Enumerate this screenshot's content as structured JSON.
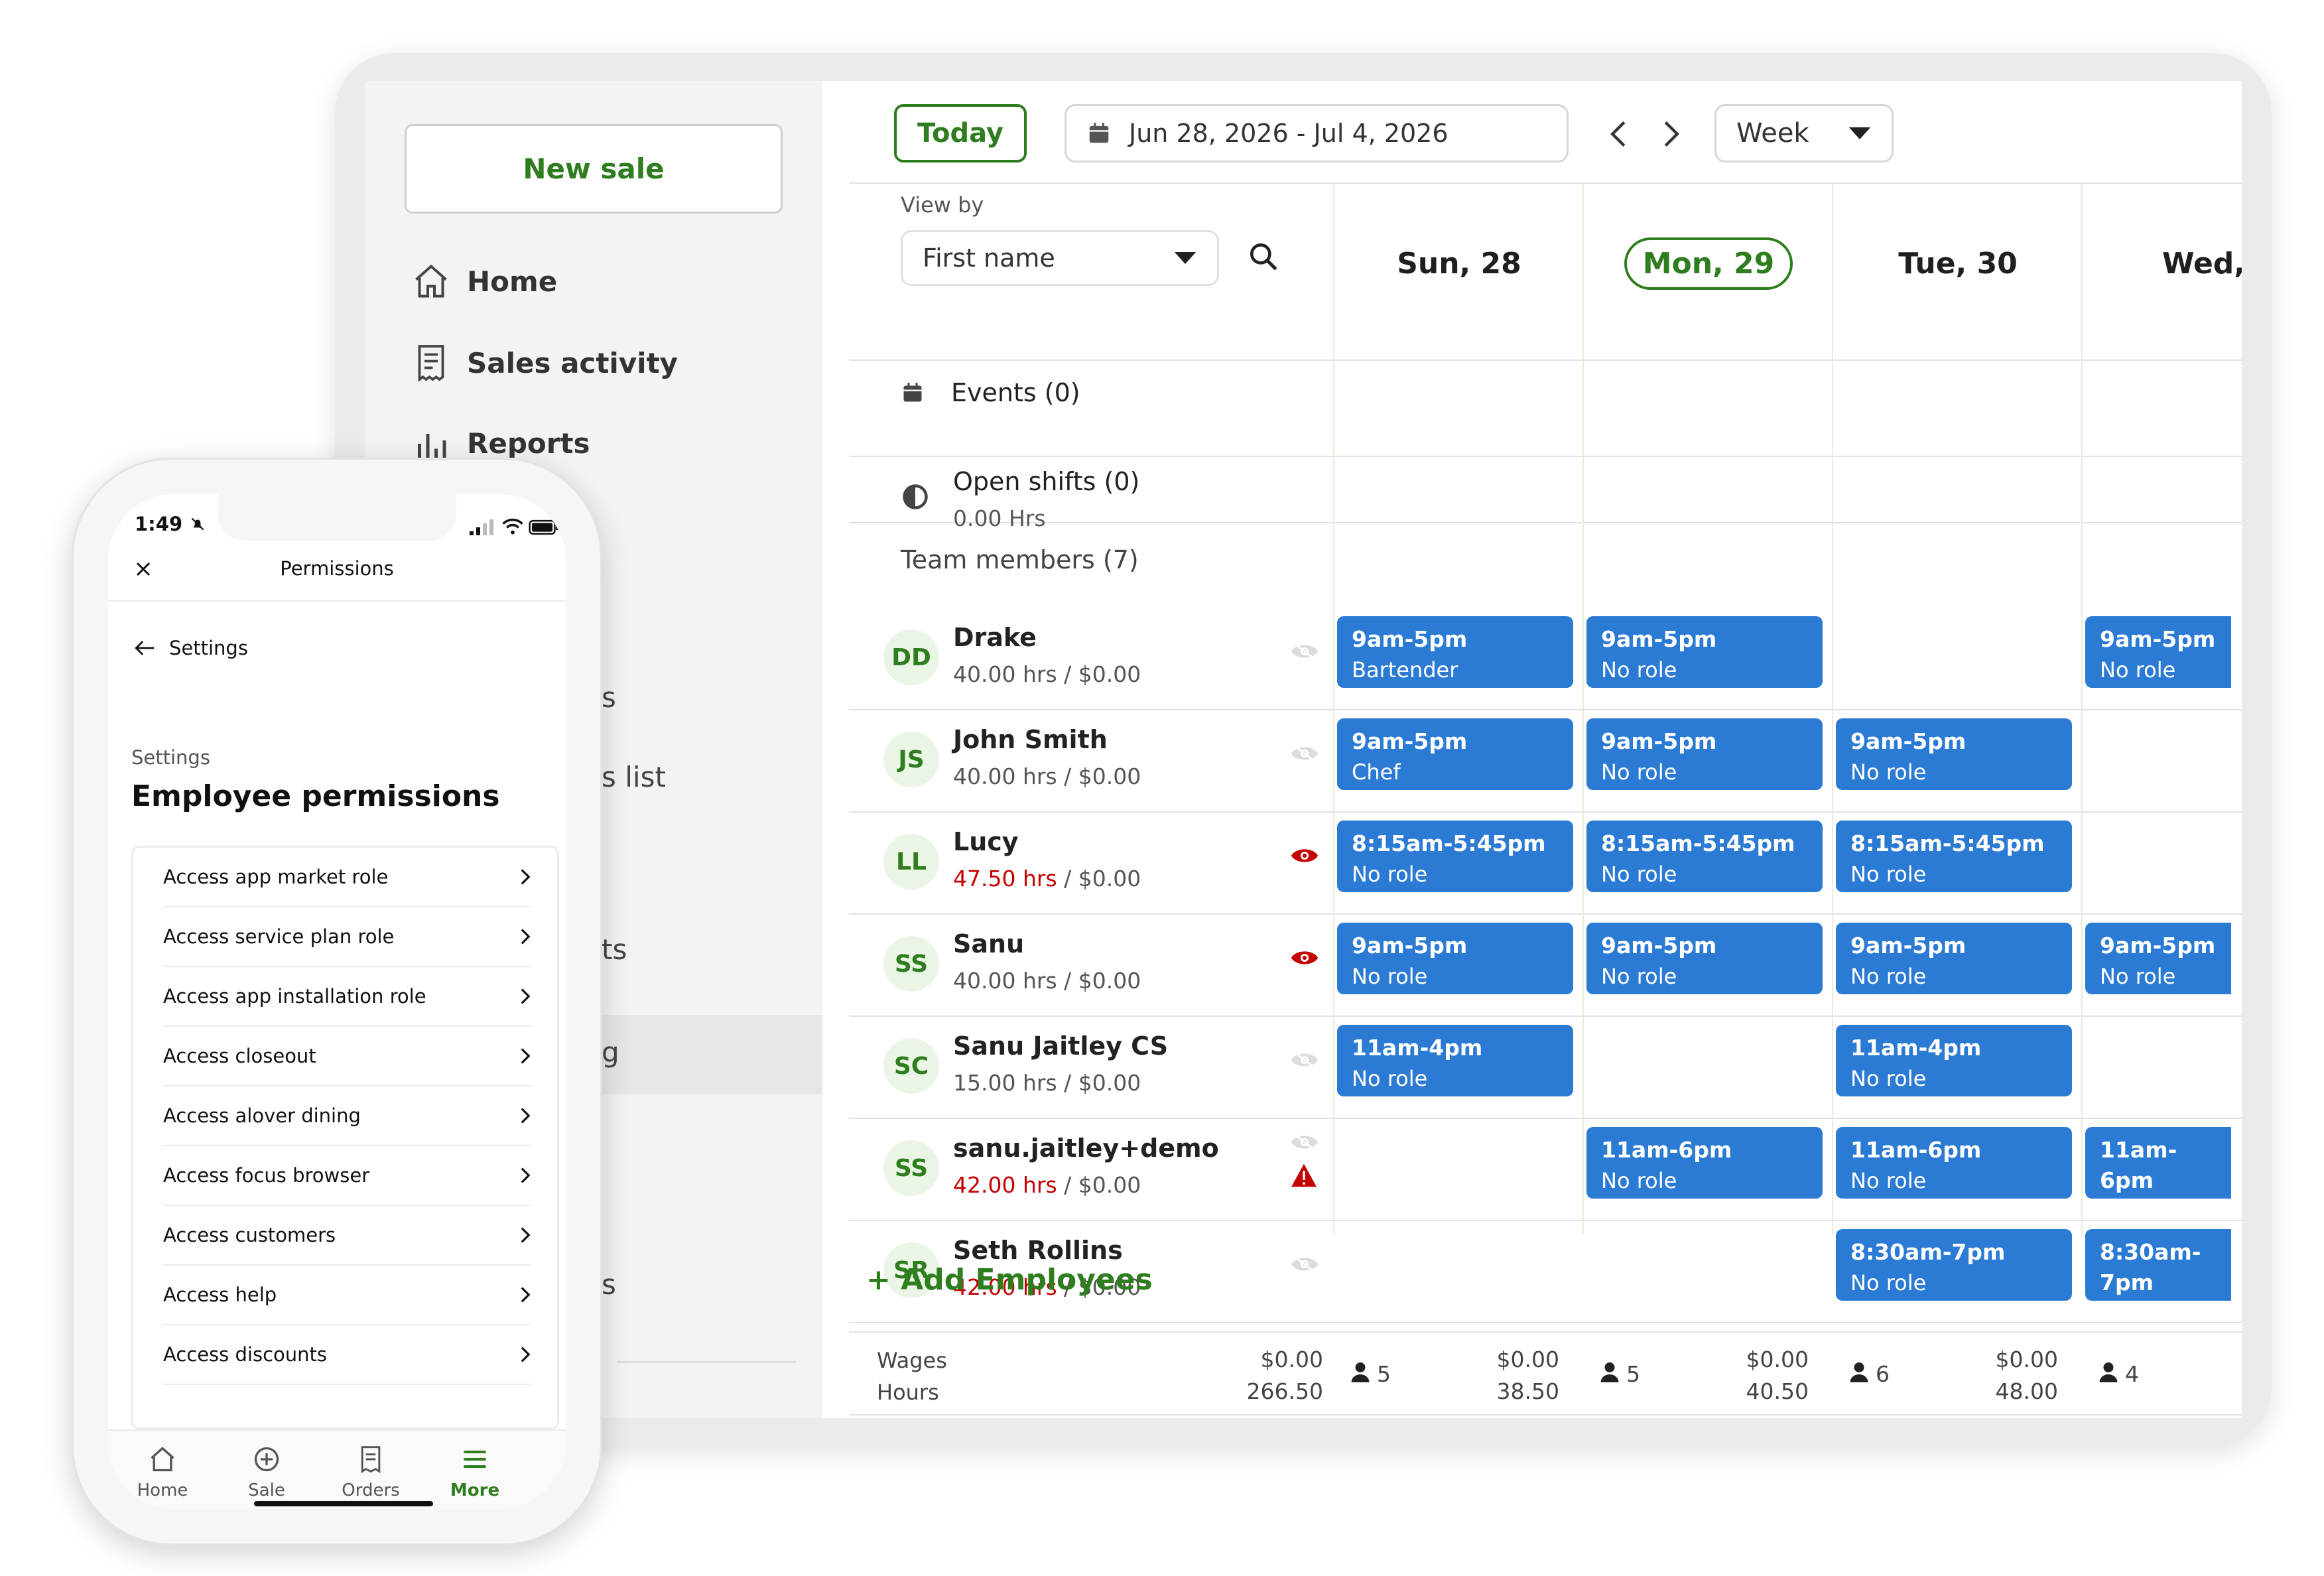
{
  "sidebar": {
    "new_sale": "New sale",
    "items": [
      {
        "label": "Home",
        "icon": "home-icon"
      },
      {
        "label": "Sales activity",
        "icon": "receipt-icon"
      },
      {
        "label": "Reports",
        "icon": "bar-chart-icon"
      }
    ],
    "fragments": [
      "s",
      "s list",
      "ts",
      "g",
      "s"
    ]
  },
  "toolbar": {
    "today": "Today",
    "date_range": "Jun 28, 2026 - Jul 4, 2026",
    "view_mode": "Week"
  },
  "grid": {
    "view_by_label": "View by",
    "view_by_value": "First name",
    "events": "Events (0)",
    "open_shifts": "Open shifts (0)",
    "open_shifts_hours": "0.00 Hrs",
    "team_members": "Team members (7)",
    "days": [
      "Sun, 28",
      "Mon, 29",
      "Tue, 30",
      "Wed,"
    ],
    "add_employees": "+ Add Employees",
    "footer": {
      "wages_label": "Wages",
      "hours_label": "Hours",
      "total_wages": "$0.00",
      "total_hours": "266.50",
      "days": [
        {
          "count": "5",
          "wages": "$0.00",
          "hours": "38.50"
        },
        {
          "count": "5",
          "wages": "$0.00",
          "hours": "40.50"
        },
        {
          "count": "6",
          "wages": "$0.00",
          "hours": "48.00"
        },
        {
          "count": "4",
          "wages": "",
          "hours": ""
        }
      ]
    }
  },
  "employees": [
    {
      "initials": "DD",
      "name": "Drake",
      "hours": "40.00 hrs",
      "pay": " / $0.00",
      "over": false,
      "visibility": "hidden"
    },
    {
      "initials": "JS",
      "name": "John Smith",
      "hours": "40.00 hrs",
      "pay": " / $0.00",
      "over": false,
      "visibility": "hidden"
    },
    {
      "initials": "LL",
      "name": "Lucy",
      "hours": "47.50 hrs",
      "pay": " / $0.00",
      "over": true,
      "visibility": "visible"
    },
    {
      "initials": "SS",
      "name": "Sanu",
      "hours": "40.00 hrs",
      "pay": " / $0.00",
      "over": false,
      "visibility": "visible"
    },
    {
      "initials": "SC",
      "name": "Sanu Jaitley CS",
      "hours": "15.00 hrs",
      "pay": " / $0.00",
      "over": false,
      "visibility": "hidden"
    },
    {
      "initials": "SS",
      "name": "sanu.jaitley+demo",
      "hours": "42.00 hrs",
      "pay": " / $0.00",
      "over": true,
      "visibility": "warning"
    },
    {
      "initials": "SR",
      "name": "Seth Rollins",
      "hours": "42.00 hrs",
      "pay": " / $0.00",
      "over": true,
      "visibility": "hidden"
    }
  ],
  "shifts": [
    {
      "row": 0,
      "day": 0,
      "time": "9am-5pm",
      "role": "Bartender"
    },
    {
      "row": 0,
      "day": 1,
      "time": "9am-5pm",
      "role": "No role"
    },
    {
      "row": 0,
      "day": 3,
      "time": "9am-5pm",
      "role": "No role"
    },
    {
      "row": 1,
      "day": 0,
      "time": "9am-5pm",
      "role": "Chef"
    },
    {
      "row": 1,
      "day": 1,
      "time": "9am-5pm",
      "role": "No role"
    },
    {
      "row": 1,
      "day": 2,
      "time": "9am-5pm",
      "role": "No role"
    },
    {
      "row": 2,
      "day": 0,
      "time": "8:15am-5:45pm",
      "role": "No role"
    },
    {
      "row": 2,
      "day": 1,
      "time": "8:15am-5:45pm",
      "role": "No role"
    },
    {
      "row": 2,
      "day": 2,
      "time": "8:15am-5:45pm",
      "role": "No role"
    },
    {
      "row": 3,
      "day": 0,
      "time": "9am-5pm",
      "role": "No role"
    },
    {
      "row": 3,
      "day": 1,
      "time": "9am-5pm",
      "role": "No role"
    },
    {
      "row": 3,
      "day": 2,
      "time": "9am-5pm",
      "role": "No role"
    },
    {
      "row": 3,
      "day": 3,
      "time": "9am-5pm",
      "role": "No role"
    },
    {
      "row": 4,
      "day": 0,
      "time": "11am-4pm",
      "role": "No role"
    },
    {
      "row": 4,
      "day": 2,
      "time": "11am-4pm",
      "role": "No role"
    },
    {
      "row": 5,
      "day": 1,
      "time": "11am-6pm",
      "role": "No role"
    },
    {
      "row": 5,
      "day": 2,
      "time": "11am-6pm",
      "role": "No role"
    },
    {
      "row": 5,
      "day": 3,
      "time": "11am-6pm",
      "role": "No role"
    },
    {
      "row": 6,
      "day": 2,
      "time": "8:30am-7pm",
      "role": "No role"
    },
    {
      "row": 6,
      "day": 3,
      "time": "8:30am-7pm",
      "role": "No role"
    }
  ],
  "phone": {
    "time": "1:49",
    "title": "Permissions",
    "back_label": "Settings",
    "section_label": "Settings",
    "heading": "Employee permissions",
    "items": [
      "Access app market role",
      "Access service plan role",
      "Access app installation role",
      "Access closeout",
      "Access alover dining",
      "Access focus browser",
      "Access customers",
      "Access help",
      "Access discounts"
    ],
    "tabs": [
      {
        "label": "Home",
        "icon": "home-icon",
        "active": false
      },
      {
        "label": "Sale",
        "icon": "plus-circle-icon",
        "active": false
      },
      {
        "label": "Orders",
        "icon": "receipt-icon",
        "active": false
      },
      {
        "label": "More",
        "icon": "menu-icon",
        "active": true
      }
    ]
  },
  "colors": {
    "brand_green": "#2e7d1e",
    "shift_blue": "#2b7bd4",
    "over_red": "#c40000"
  }
}
